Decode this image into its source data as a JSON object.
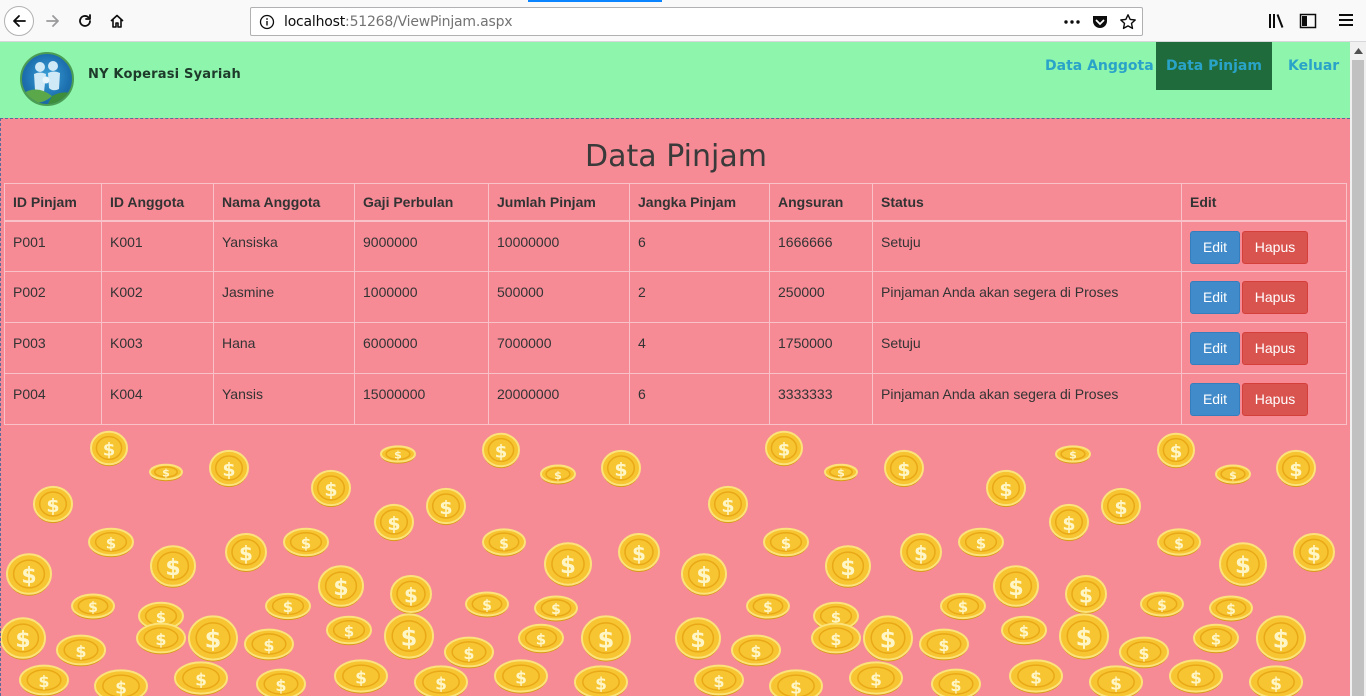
{
  "browser": {
    "url_host": "localhost",
    "url_rest": ":51268/ViewPinjam.aspx"
  },
  "site": {
    "brand": "NY Koperasi Syariah",
    "nav": [
      {
        "label": "Data Anggota",
        "active": false
      },
      {
        "label": "Data Pinjam",
        "active": true
      },
      {
        "label": "Keluar",
        "active": false
      }
    ],
    "colors": {
      "header_bg": "#8ef5ad",
      "active_nav_bg": "#1f6b3b",
      "nav_text": "#2aa3c9",
      "content_bg": "#f68b96",
      "edit_button": "#428bca",
      "hapus_button": "#d9534f"
    }
  },
  "page": {
    "title": "Data Pinjam",
    "table": {
      "headers": [
        "ID Pinjam",
        "ID Anggota",
        "Nama Anggota",
        "Gaji Perbulan",
        "Jumlah Pinjam",
        "Jangka Pinjam",
        "Angsuran",
        "Status",
        "Edit"
      ],
      "rows": [
        {
          "id_pinjam": "P001",
          "id_anggota": "K001",
          "nama": "Yansiska",
          "gaji": "9000000",
          "jumlah": "10000000",
          "jangka": "6",
          "angsuran": "1666666",
          "status": "Setuju"
        },
        {
          "id_pinjam": "P002",
          "id_anggota": "K002",
          "nama": "Jasmine",
          "gaji": "1000000",
          "jumlah": "500000",
          "jangka": "2",
          "angsuran": "250000",
          "status": "Pinjaman Anda akan segera di Proses"
        },
        {
          "id_pinjam": "P003",
          "id_anggota": "K003",
          "nama": "Hana",
          "gaji": "6000000",
          "jumlah": "7000000",
          "jangka": "4",
          "angsuran": "1750000",
          "status": "Setuju"
        },
        {
          "id_pinjam": "P004",
          "id_anggota": "K004",
          "nama": "Yansis",
          "gaji": "15000000",
          "jumlah": "20000000",
          "jangka": "6",
          "angsuran": "3333333",
          "status": "Pinjaman Anda akan segera di Proses"
        }
      ],
      "edit_label": "Edit",
      "hapus_label": "Hapus"
    }
  }
}
